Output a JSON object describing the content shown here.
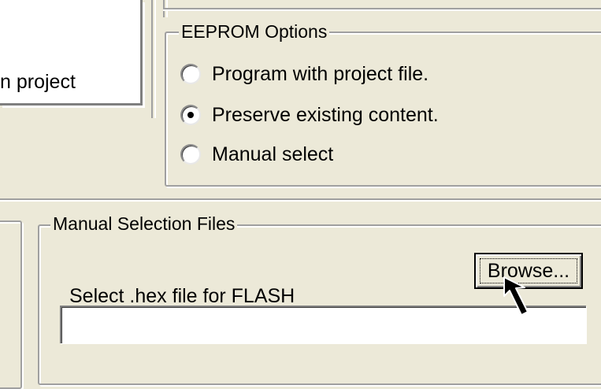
{
  "left": {
    "cropped_label": "n project"
  },
  "eeprom": {
    "legend": "EEPROM Options",
    "options": [
      {
        "label": "Program with project file.",
        "selected": false
      },
      {
        "label": "Preserve existing content.",
        "selected": true
      },
      {
        "label": "Manual select",
        "selected": false
      }
    ]
  },
  "manual": {
    "legend": "Manual Selection Files",
    "select_label": "Select .hex file for FLASH",
    "browse_label": "Browse...",
    "hex_value": "",
    "hex_placeholder": ""
  },
  "icons": {
    "cursor": "mouse-pointer-arrow-icon"
  }
}
